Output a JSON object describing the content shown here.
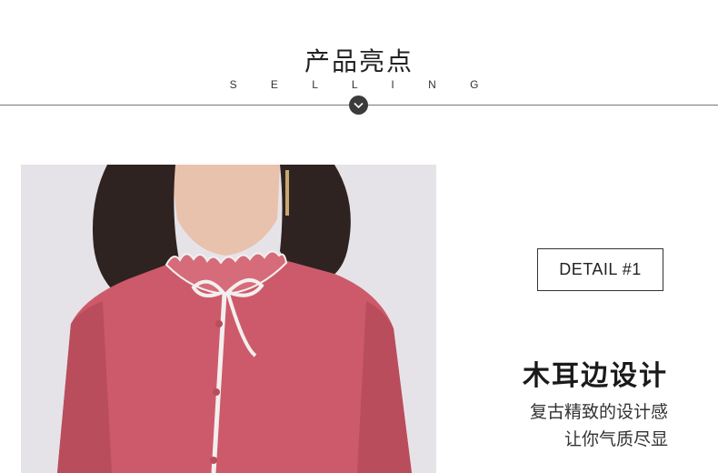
{
  "header": {
    "title": "产品亮点",
    "subtitle": "S E L L I N G"
  },
  "detail": {
    "label": "DETAIL #1",
    "title": "木耳边设计",
    "lines": [
      "复古精致的设计感",
      "让你气质尽显"
    ]
  },
  "icons": {
    "section_toggle": "chevron-down-icon"
  },
  "colors": {
    "blouse": "#cd5a6a",
    "background_photo": "#e6e3e8",
    "accent_dark": "#3b3b3b"
  }
}
